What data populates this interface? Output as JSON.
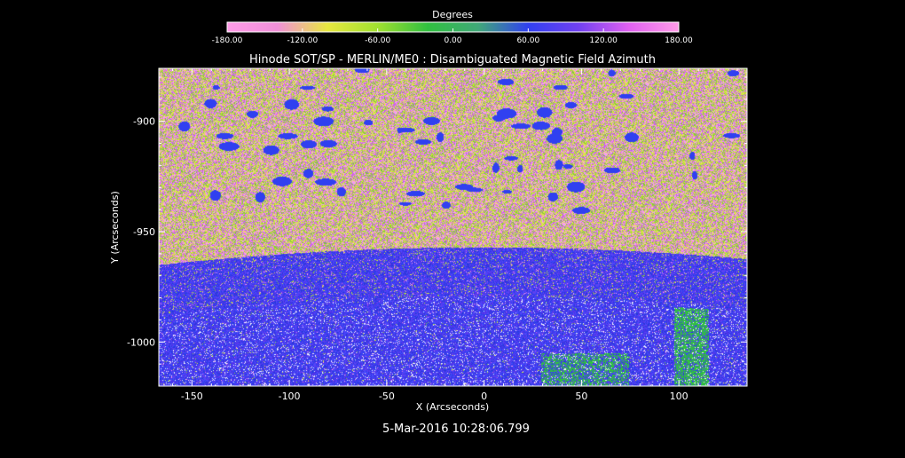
{
  "chart_data": {
    "type": "heatmap",
    "title": "Hinode SOT/SP - MERLIN/ME0 : Disambiguated Magnetic Field Azimuth",
    "xlabel": "X (Arcseconds)",
    "ylabel": "Y (Arcseconds)",
    "timestamp": "5-Mar-2016 10:28:06.799",
    "xlim": [
      -167,
      135
    ],
    "ylim": [
      -1020,
      -876
    ],
    "x_ticks": [
      -150,
      -100,
      -50,
      0,
      50,
      100
    ],
    "x_tick_labels": [
      "-150",
      "-100",
      "-50",
      "0",
      "50",
      "100"
    ],
    "y_ticks": [
      -900,
      -950,
      -1000
    ],
    "y_tick_labels": [
      "-900",
      "-950",
      "-1000"
    ],
    "colorbar": {
      "label": "Degrees",
      "range": [
        -180,
        180
      ],
      "ticks": [
        -180,
        -120,
        -60,
        0,
        60,
        120,
        180
      ],
      "tick_labels": [
        "-180.00",
        "-120.00",
        "-60.00",
        "0.00",
        "60.00",
        "120.00",
        "180.00"
      ],
      "colors": [
        "#ff9ce8",
        "#f090d8",
        "#e8e840",
        "#a0e030",
        "#30c040",
        "#40a878",
        "#3040f0",
        "#7040f0",
        "#e060f0",
        "#ff9ce8"
      ]
    },
    "limb_y": -965,
    "grid": false,
    "background_color": "#000000"
  }
}
